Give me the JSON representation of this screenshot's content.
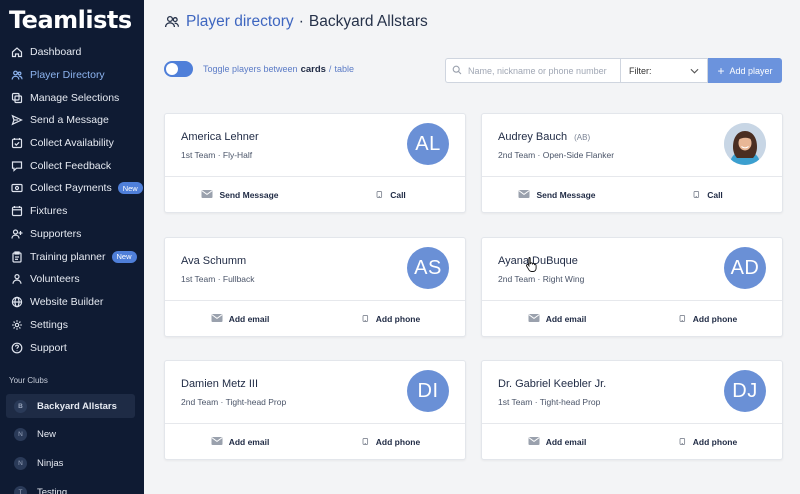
{
  "app": {
    "logo": "Teamlists"
  },
  "sidebar": {
    "items": [
      {
        "label": "Dashboard",
        "icon": "home-icon"
      },
      {
        "label": "Player Directory",
        "icon": "players-icon",
        "active": true
      },
      {
        "label": "Manage Selections",
        "icon": "selections-icon"
      },
      {
        "label": "Send a Message",
        "icon": "send-icon"
      },
      {
        "label": "Collect Availability",
        "icon": "calendar-check-icon"
      },
      {
        "label": "Collect Feedback",
        "icon": "feedback-icon"
      },
      {
        "label": "Collect Payments",
        "icon": "payments-icon",
        "badge": "New"
      },
      {
        "label": "Fixtures",
        "icon": "fixtures-icon"
      },
      {
        "label": "Supporters",
        "icon": "supporters-icon"
      },
      {
        "label": "Training planner",
        "icon": "clipboard-icon",
        "badge": "New"
      },
      {
        "label": "Volunteers",
        "icon": "volunteers-icon"
      },
      {
        "label": "Website Builder",
        "icon": "globe-icon"
      },
      {
        "label": "Settings",
        "icon": "gear-icon"
      },
      {
        "label": "Support",
        "icon": "help-icon"
      }
    ],
    "clubs_label": "Your Clubs",
    "clubs": [
      {
        "initial": "B",
        "name": "Backyard Allstars",
        "active": true
      },
      {
        "initial": "N",
        "name": "New"
      },
      {
        "initial": "N",
        "name": "Ninjas"
      },
      {
        "initial": "T",
        "name": "Testing"
      }
    ]
  },
  "header": {
    "title": "Player directory",
    "separator": "·",
    "club": "Backyard Allstars"
  },
  "toolbar": {
    "toggle_prefix": "Toggle players between",
    "toggle_cards": "cards",
    "toggle_slash": "/",
    "toggle_table": "table",
    "search_placeholder": "Name, nickname or phone number",
    "filter_label": "Filter:",
    "add_player": "Add player"
  },
  "colors": {
    "accent": "#4f7fd9",
    "sidebar": "#0f1b33",
    "avatar": "#6a90d6"
  },
  "players": [
    {
      "name": "America Lehner",
      "nickname": "",
      "sub": "1st Team · Fly-Half",
      "initials": "AL",
      "photo": false,
      "action1": "Send Message",
      "action1_icon": "email-icon",
      "action2": "Call",
      "action2_icon": "phone-icon"
    },
    {
      "name": "Audrey Bauch",
      "nickname": "(AB)",
      "sub": "2nd Team · Open-Side Flanker",
      "initials": "",
      "photo": true,
      "action1": "Send Message",
      "action1_icon": "email-icon",
      "action2": "Call",
      "action2_icon": "phone-icon"
    },
    {
      "name": "Ava Schumm",
      "nickname": "",
      "sub": "1st Team · Fullback",
      "initials": "AS",
      "photo": false,
      "action1": "Add email",
      "action1_icon": "email-icon",
      "action2": "Add phone",
      "action2_icon": "phone-icon"
    },
    {
      "name": "Ayana DuBuque",
      "nickname": "",
      "sub": "2nd Team · Right Wing",
      "initials": "AD",
      "photo": false,
      "action1": "Add email",
      "action1_icon": "email-icon",
      "action2": "Add phone",
      "action2_icon": "phone-icon"
    },
    {
      "name": "Damien Metz III",
      "nickname": "",
      "sub": "2nd Team · Tight-head Prop",
      "initials": "DI",
      "photo": false,
      "action1": "Add email",
      "action1_icon": "email-icon",
      "action2": "Add phone",
      "action2_icon": "phone-icon"
    },
    {
      "name": "Dr. Gabriel Keebler Jr.",
      "nickname": "",
      "sub": "1st Team · Tight-head Prop",
      "initials": "DJ",
      "photo": false,
      "action1": "Add email",
      "action1_icon": "email-icon",
      "action2": "Add phone",
      "action2_icon": "phone-icon"
    }
  ]
}
